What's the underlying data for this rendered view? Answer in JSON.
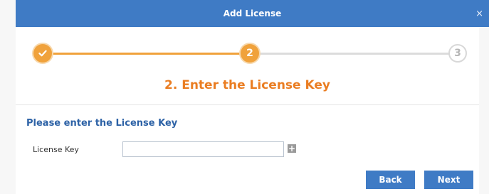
{
  "window": {
    "title": "Add License",
    "close_glyph": "×"
  },
  "stepper": {
    "steps": [
      {
        "label": "1",
        "state": "done",
        "icon": "checkmark-icon"
      },
      {
        "label": "2",
        "state": "current"
      },
      {
        "label": "3",
        "state": "pending"
      }
    ],
    "current_step": 2
  },
  "step_heading": "2. Enter the License Key",
  "form": {
    "section_title": "Please enter the License Key",
    "license_key_label": "License Key",
    "license_key_value": "",
    "add_glyph": "+"
  },
  "buttons": {
    "back": "Back",
    "next": "Next"
  },
  "colors": {
    "titlebar": "#3f7bc5",
    "accent_orange": "#f0a23c",
    "heading_orange": "#ea7d22",
    "section_blue": "#2d62a6",
    "button_blue": "#3f7bc5"
  }
}
